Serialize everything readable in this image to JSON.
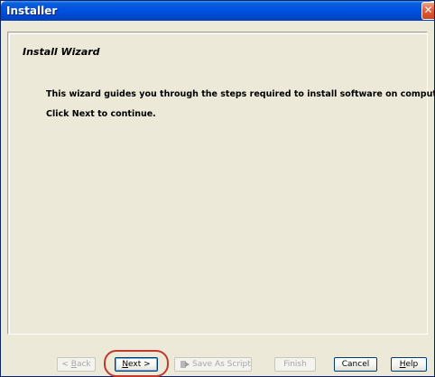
{
  "window": {
    "title": "Installer",
    "close_glyph": "✕"
  },
  "wizard": {
    "heading": "Install Wizard",
    "line1": "This wizard guides you through the steps required to install software on computers.",
    "line2": "Click Next to continue."
  },
  "buttons": {
    "back": {
      "prefix": "< ",
      "mnemonic": "B",
      "rest": "ack",
      "enabled": false
    },
    "next": {
      "mnemonic": "N",
      "rest": "ext >",
      "enabled": true
    },
    "save_script": {
      "label": "Save As Script",
      "icon": "script-arrow-icon",
      "enabled": false
    },
    "finish": {
      "label": "Finish",
      "enabled": false
    },
    "cancel": {
      "label": "Cancel",
      "enabled": true
    },
    "help": {
      "mnemonic": "H",
      "rest": "elp",
      "enabled": true
    }
  },
  "colors": {
    "titlebar": "#0054e3",
    "dialog_bg": "#ece9d8",
    "highlight": "#c0392b"
  }
}
